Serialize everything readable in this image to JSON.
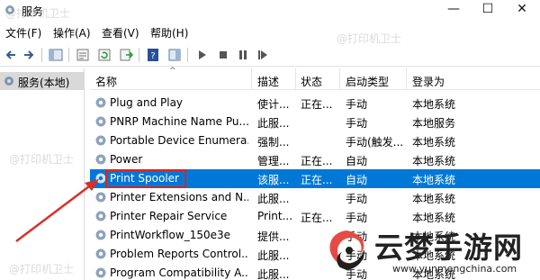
{
  "window": {
    "title": "服务",
    "minimize": "—",
    "maximize": "☐",
    "close": "✕"
  },
  "menu": [
    "文件(F)",
    "操作(A)",
    "查看(V)",
    "帮助(H)"
  ],
  "tree": {
    "root_label": "服务(本地)"
  },
  "columns": [
    "名称",
    "描述",
    "状态",
    "启动类型",
    "登录为"
  ],
  "rows": [
    {
      "name": "Plug and Play",
      "desc": "使计...",
      "status": "正在...",
      "startup": "手动",
      "logon": "本地系统"
    },
    {
      "name": "PNRP Machine Name Pu...",
      "desc": "此服...",
      "status": "",
      "startup": "手动",
      "logon": "本地服务"
    },
    {
      "name": "Portable Device Enumera...",
      "desc": "强制...",
      "status": "",
      "startup": "手动(触发...",
      "logon": "本地系统"
    },
    {
      "name": "Power",
      "desc": "管理...",
      "status": "正在...",
      "startup": "自动",
      "logon": "本地系统"
    },
    {
      "name": "Print Spooler",
      "desc": "该服...",
      "status": "正在...",
      "startup": "自动",
      "logon": "本地系统"
    },
    {
      "name": "Printer Extensions and N...",
      "desc": "此服...",
      "status": "",
      "startup": "手动",
      "logon": "本地系统"
    },
    {
      "name": "Printer Repair Service",
      "desc": "Print...",
      "status": "正在...",
      "startup": "手动",
      "logon": "本地系统"
    },
    {
      "name": "PrintWorkflow_150e3e",
      "desc": "提供...",
      "status": "",
      "startup": "手动",
      "logon": "本地系统"
    },
    {
      "name": "Problem Reports Control...",
      "desc": "此服...",
      "status": "",
      "startup": "手动",
      "logon": "本地系统"
    },
    {
      "name": "Program Compatibility A...",
      "desc": "此服...",
      "status": "",
      "startup": "手动",
      "logon": "本地系统"
    }
  ],
  "selected_row": 4,
  "watermark": "@打印机卫士",
  "brand": {
    "name": "云梦手游网",
    "url": "www.yunmengchina.com"
  },
  "colors": {
    "selection": "#0078d7",
    "highlight_box": "#e0221e",
    "arrow": "#d8302a"
  }
}
